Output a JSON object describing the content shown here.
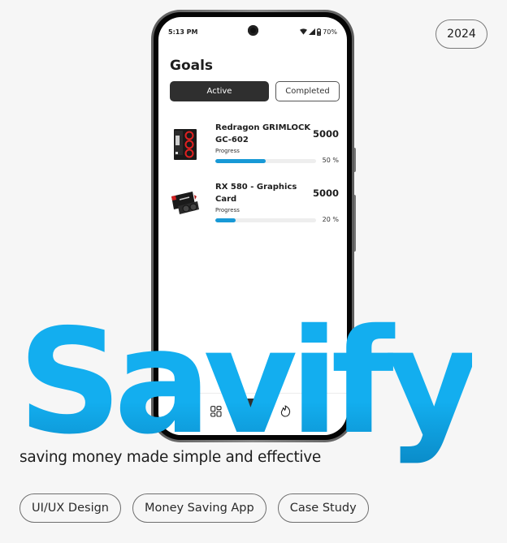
{
  "year_badge": "2024",
  "phone": {
    "status_bar": {
      "time": "5:13 PM",
      "battery": "70%",
      "icons": [
        "wifi-icon",
        "signal-icon",
        "battery-icon"
      ]
    },
    "page_title": "Goals",
    "tabs": [
      {
        "label": "Active",
        "selected": true
      },
      {
        "label": "Completed",
        "selected": false
      }
    ],
    "goals": [
      {
        "name": "Redragon GRIMLOCK GC-602",
        "image": "pc-case-image",
        "amount": "5000",
        "progress_label": "Progress",
        "progress_value": 50,
        "progress_text": "50 %"
      },
      {
        "name": "RX 580 - Graphics Card",
        "image": "graphics-card-image",
        "amount": "5000",
        "progress_label": "Progress",
        "progress_value": 20,
        "progress_text": "20 %"
      }
    ],
    "bottom_nav": {
      "items": [
        "grid-icon",
        "add-icon",
        "flame-icon"
      ],
      "add_symbol": "+"
    }
  },
  "brand": {
    "title": "Savify",
    "tagline": "saving money made simple and effective",
    "accent_color": "#13AEEF"
  },
  "tags": [
    "UI/UX Design",
    "Money Saving App",
    "Case Study"
  ]
}
